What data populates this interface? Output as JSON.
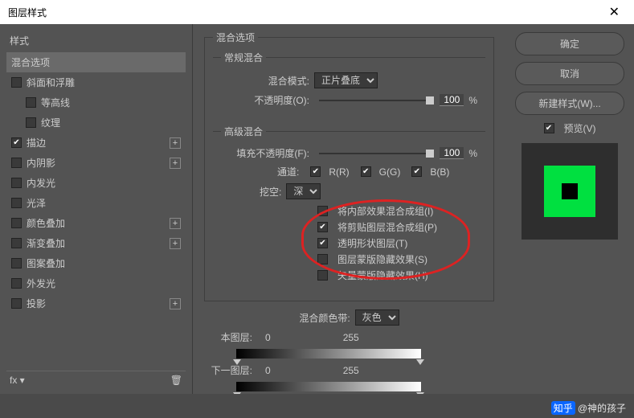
{
  "title": "图层样式",
  "sidebar": {
    "header": "样式",
    "items": [
      {
        "label": "混合选项",
        "checked": null,
        "selected": true,
        "indent": false,
        "plus": false
      },
      {
        "label": "斜面和浮雕",
        "checked": false,
        "indent": false,
        "plus": false
      },
      {
        "label": "等高线",
        "checked": false,
        "indent": true,
        "plus": false
      },
      {
        "label": "纹理",
        "checked": false,
        "indent": true,
        "plus": false
      },
      {
        "label": "描边",
        "checked": true,
        "indent": false,
        "plus": true
      },
      {
        "label": "内阴影",
        "checked": false,
        "indent": false,
        "plus": true
      },
      {
        "label": "内发光",
        "checked": false,
        "indent": false,
        "plus": false
      },
      {
        "label": "光泽",
        "checked": false,
        "indent": false,
        "plus": false
      },
      {
        "label": "颜色叠加",
        "checked": false,
        "indent": false,
        "plus": true
      },
      {
        "label": "渐变叠加",
        "checked": false,
        "indent": false,
        "plus": true
      },
      {
        "label": "图案叠加",
        "checked": false,
        "indent": false,
        "plus": false
      },
      {
        "label": "外发光",
        "checked": false,
        "indent": false,
        "plus": false
      },
      {
        "label": "投影",
        "checked": false,
        "indent": false,
        "plus": true
      }
    ],
    "footer": {
      "fx": "fx",
      "trash": "🗑"
    }
  },
  "center": {
    "panel_title": "混合选项",
    "normal_group": "常规混合",
    "blend_mode_label": "混合模式:",
    "blend_mode_value": "正片叠底",
    "opacity_label": "不透明度(O):",
    "opacity_value": "100",
    "percent": "%",
    "advanced_group": "高级混合",
    "fill_label": "填充不透明度(F):",
    "fill_value": "100",
    "channels_label": "通道:",
    "ch_r": "R(R)",
    "ch_g": "G(G)",
    "ch_b": "B(B)",
    "knockout_label": "挖空:",
    "knockout_value": "深",
    "inner": [
      {
        "label": "将内部效果混合成组(I)",
        "checked": false
      },
      {
        "label": "将剪贴图层混合成组(P)",
        "checked": true
      },
      {
        "label": "透明形状图层(T)",
        "checked": true
      },
      {
        "label": "图层蒙版隐藏效果(S)",
        "checked": false
      },
      {
        "label": "矢量蒙版隐藏效果(H)",
        "checked": false
      }
    ],
    "blendif_label": "混合颜色带:",
    "blendif_value": "灰色",
    "this_layer": "本图层:",
    "this_vals": [
      "0",
      "255"
    ],
    "next_layer": "下一图层:",
    "next_vals": [
      "0",
      "255"
    ]
  },
  "right": {
    "ok": "确定",
    "cancel": "取消",
    "newstyle": "新建样式(W)...",
    "preview": "预览(V)"
  },
  "watermark": {
    "src": "知乎",
    "user": "@神的孩子"
  }
}
